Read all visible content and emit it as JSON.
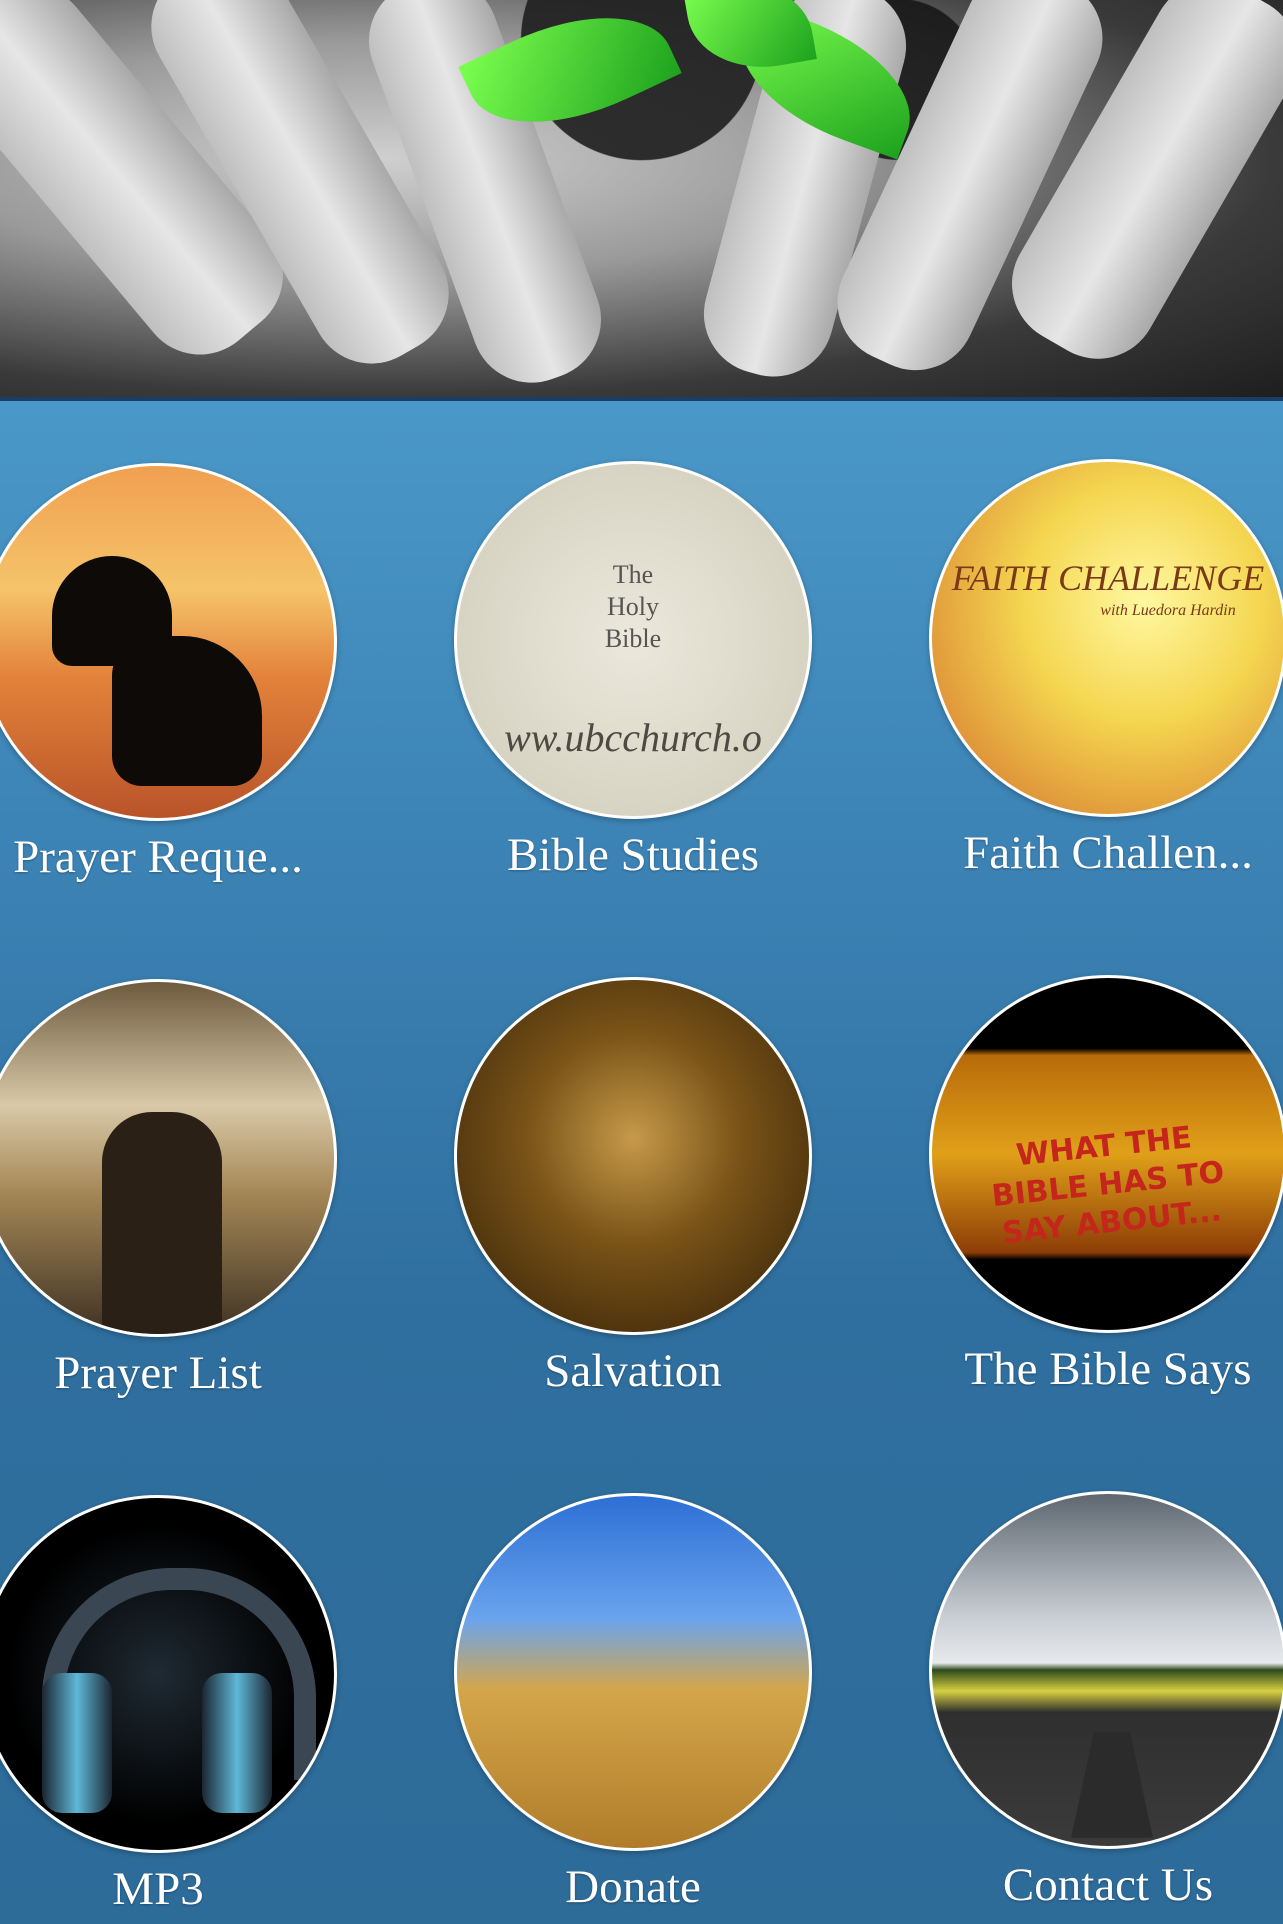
{
  "header": {
    "banner_image": "hands-planting-seedling"
  },
  "menu": {
    "tiles": [
      {
        "label": "Prayer Reque...",
        "image": "praying-man-silhouette"
      },
      {
        "label": "Bible Studies",
        "image": "holy-bible-emblem",
        "image_text": {
          "title": "The Holy Bible",
          "url": "ww.ubcchurch.o"
        }
      },
      {
        "label": "Faith Challen...",
        "image": "faith-challenge-sunset",
        "image_text": {
          "title": "FAITH CHALLENGE",
          "subtitle": "with Luedora Hardin"
        }
      },
      {
        "label": "Prayer List",
        "image": "raised-hands-sky"
      },
      {
        "label": "Salvation",
        "image": "water-pouring-hands"
      },
      {
        "label": "The Bible Says",
        "image": "what-the-bible-has-to-say-banner",
        "image_text": {
          "title": "WHAT THE BIBLE HAS TO SAY ABOUT..."
        }
      },
      {
        "label": "MP3",
        "image": "headphones"
      },
      {
        "label": "Donate",
        "image": "wheat-field-sky"
      },
      {
        "label": "Contact Us",
        "image": "open-road-horizon"
      }
    ]
  },
  "colors": {
    "background_top": "#4a98c8",
    "background_bottom": "#2d6b99",
    "label_text": "#ffffff",
    "circle_border": "#ffffff"
  }
}
